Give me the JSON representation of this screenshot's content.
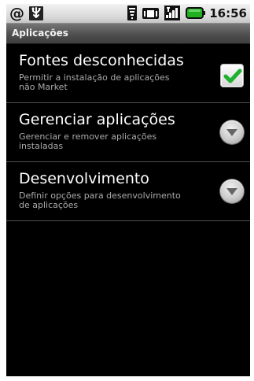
{
  "status_bar": {
    "time": "16:56",
    "icons": [
      "at-icon",
      "usb-icon",
      "wifi-icon",
      "vibrate-icon",
      "signal-icon",
      "battery-icon"
    ],
    "colors": {
      "status_background": "#d8d8d8",
      "status_text": "#111111",
      "battery": "#20b020"
    }
  },
  "title_bar": {
    "title": "Aplicações"
  },
  "settings": [
    {
      "title": "Fontes desconhecidas",
      "summary": "Permitir a instalação de aplicações\nnão Market",
      "control": "checkbox",
      "checked": true
    },
    {
      "title": "Gerenciar aplicações",
      "summary": "Gerenciar e remover aplicações\ninstaladas",
      "control": "chevron-down-icon"
    },
    {
      "title": "Desenvolvimento",
      "summary": "Definir opções para desenvolvimento\nde aplicações",
      "control": "chevron-down-icon"
    }
  ],
  "colors": {
    "screen_background": "#000000",
    "primary_text": "#ffffff",
    "secondary_text": "#aaaaaa",
    "check": "#20b030",
    "title_text": "#f2f2f2"
  }
}
